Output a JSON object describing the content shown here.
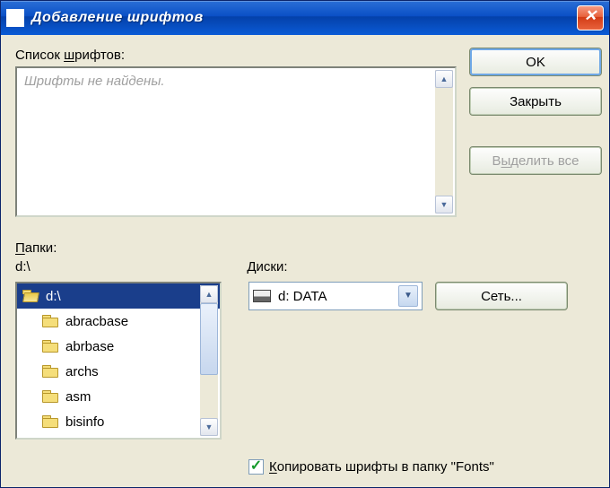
{
  "title": "Добавление шрифтов",
  "fontlist_label_pre": "Список ",
  "fontlist_label_u": "ш",
  "fontlist_label_post": "рифтов:",
  "fontlist_placeholder": "Шрифты не найдены.",
  "buttons": {
    "ok": "OK",
    "close": "Закрыть",
    "select_all_pre": "В",
    "select_all_u": "ы",
    "select_all_post": "делить все",
    "network": "Сеть..."
  },
  "folders_label_u": "П",
  "folders_label_post": "апки:",
  "current_path": "d:\\",
  "drives_label": "Диски:",
  "drive_selected": "d: DATA",
  "copy_checkbox_pre": "",
  "copy_checkbox_u": "К",
  "copy_checkbox_post": "опировать шрифты в папку \"Fonts\"",
  "copy_checked": true,
  "tree": [
    {
      "label": "d:\\",
      "open": true,
      "selected": true,
      "indent": 0
    },
    {
      "label": "abracbase",
      "open": false,
      "selected": false,
      "indent": 1
    },
    {
      "label": "abrbase",
      "open": false,
      "selected": false,
      "indent": 1
    },
    {
      "label": "archs",
      "open": false,
      "selected": false,
      "indent": 1
    },
    {
      "label": "asm",
      "open": false,
      "selected": false,
      "indent": 1
    },
    {
      "label": "bisinfo",
      "open": false,
      "selected": false,
      "indent": 1
    }
  ]
}
